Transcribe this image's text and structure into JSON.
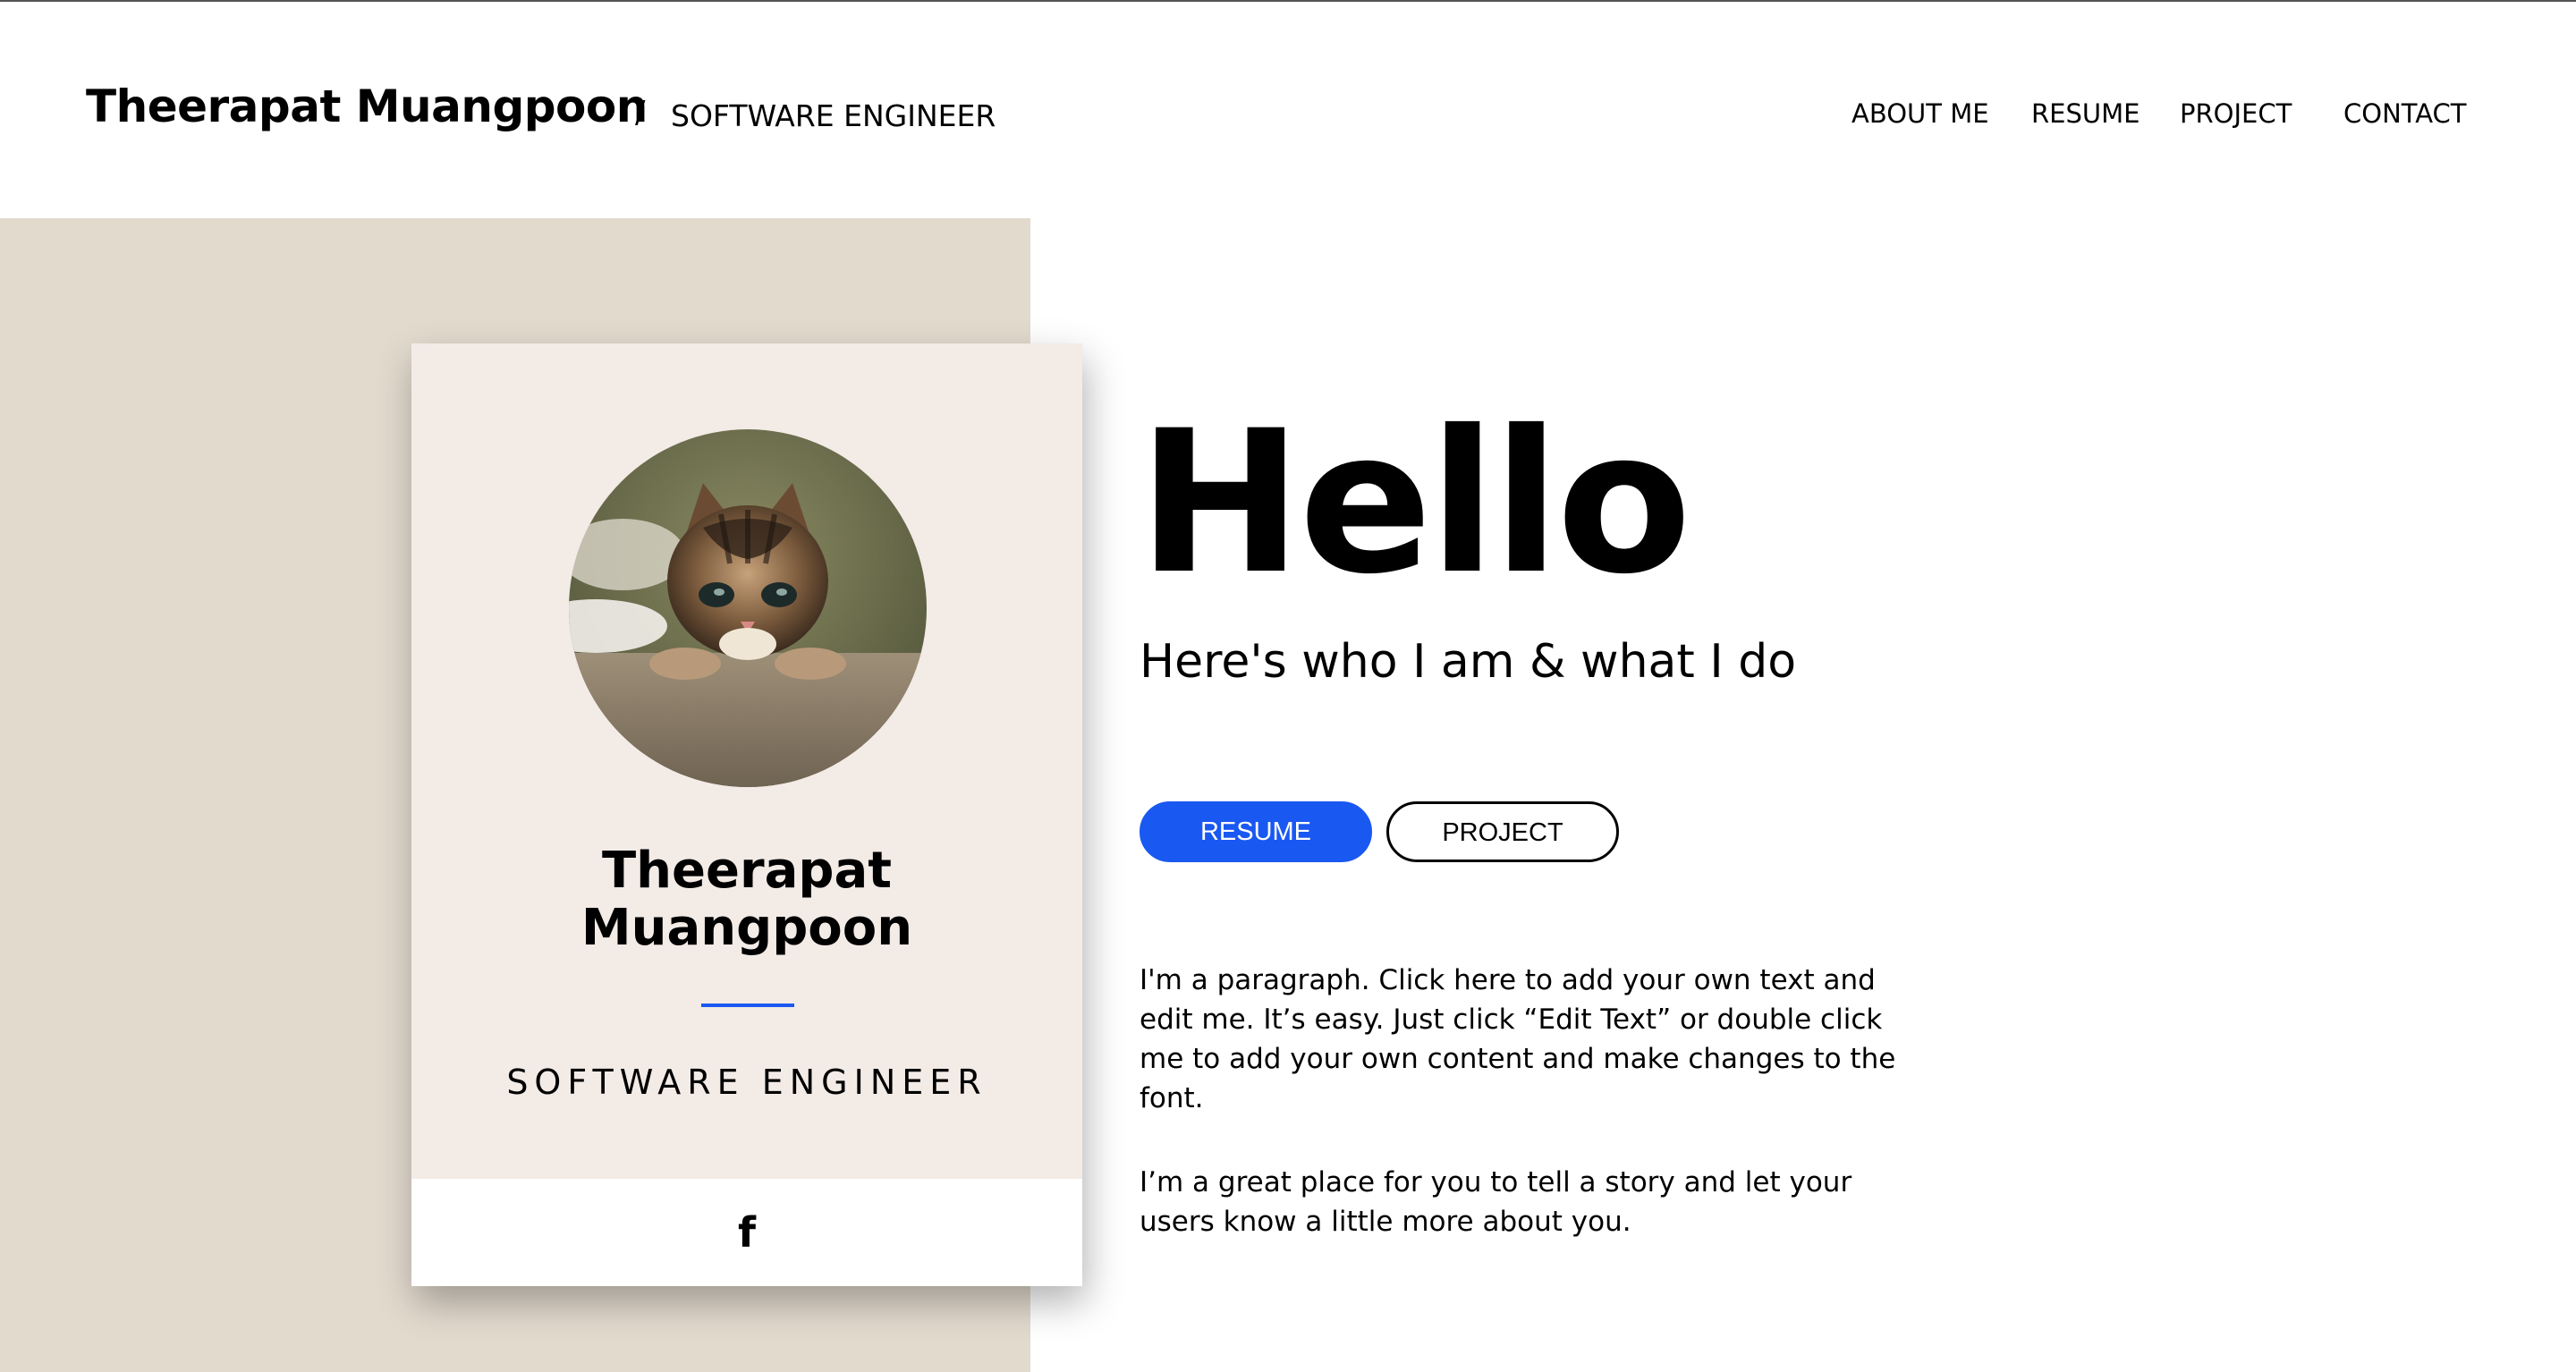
{
  "header": {
    "site_title": "Theerapat Muangpoon",
    "separator": "/",
    "site_subtitle": "SOFTWARE ENGINEER",
    "nav": {
      "about": "ABOUT ME",
      "resume": "RESUME",
      "project": "PROJECT",
      "contact": "CONTACT"
    }
  },
  "card": {
    "avatar_icon": "kitten-photo",
    "name_line_1": "Theerapat",
    "name_line_2": "Muangpoon",
    "role": "SOFTWARE ENGINEER",
    "social_icon": "facebook-icon",
    "facebook_glyph": "f"
  },
  "main": {
    "heading": "Hello",
    "tagline": "Here's who I am & what I do",
    "buttons": {
      "resume": "RESUME",
      "project": "PROJECT"
    },
    "paragraphs": [
      "I'm a paragraph. Click here to add your own text and edit me. It’s easy. Just click “Edit Text” or double click me to add your own content and make changes to the font.",
      "I’m a great place for you to tell a story and let your users know a little more about you."
    ]
  },
  "colors": {
    "accent": "#1a58f2",
    "panel_beige": "#e3dace",
    "card_background": "#f3ebe6",
    "background": "#ffffff",
    "text": "#000000"
  }
}
